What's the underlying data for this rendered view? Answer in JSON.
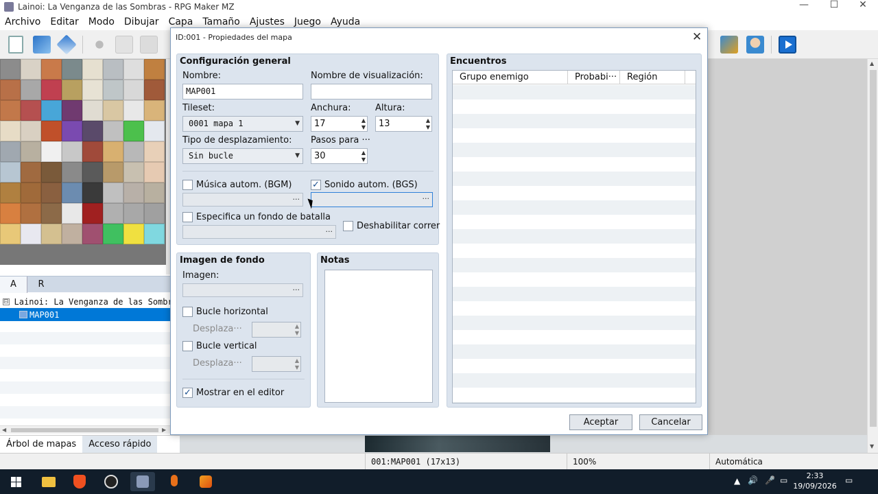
{
  "window": {
    "title": "Lainoi: La Venganza de las Sombras - RPG Maker MZ",
    "minimize": "—",
    "maximize": "☐",
    "close": "✕"
  },
  "menubar": [
    "Archivo",
    "Editar",
    "Modo",
    "Dibujar",
    "Capa",
    "Tamaño",
    "Ajustes",
    "Juego",
    "Ayuda"
  ],
  "toolbar": {
    "icons": [
      "new-project-icon",
      "open-project-icon",
      "save-project-icon",
      "cut-icon",
      "copy-icon",
      "paste-icon",
      "database-icon",
      "plugin-manager-icon",
      "character-generator-icon",
      "playtest-icon"
    ]
  },
  "palette": {
    "tabs": [
      "A",
      "R"
    ],
    "tile_colors": [
      "#8c8c8c",
      "#d9d2c6",
      "#c97a4a",
      "#7b8a8c",
      "#e6e0d0",
      "#b9bec2",
      "#dedede",
      "#c08040",
      "#b87048",
      "#a8a8a8",
      "#c04050",
      "#b8a060",
      "#e7e2d4",
      "#bfc6c8",
      "#d8d8d8",
      "#a05a3a",
      "#c2784a",
      "#b55050",
      "#48a6d8",
      "#703a70",
      "#e0dcd2",
      "#d9c7a3",
      "#e8e8e8",
      "#d9b47a",
      "#e7dcc6",
      "#d9d0c2",
      "#c0502a",
      "#7a4ab0",
      "#5a4a6a",
      "#c0c0c0",
      "#4cc04c",
      "#e4e8ee",
      "#a0a8b0",
      "#b8b0a0",
      "#f0f0f0",
      "#c8c8c8",
      "#a04a3a",
      "#d8b070",
      "#b8b8b8",
      "#e8d0b8",
      "#b7c6d2",
      "#a06a40",
      "#7a5a3a",
      "#8a8a8a",
      "#5a5a5a",
      "#b89a6a",
      "#c8c0b0",
      "#e6cab2",
      "#b08040",
      "#a06a3a",
      "#8a6040",
      "#6c8cb0",
      "#3a3a3a",
      "#c0c0c0",
      "#b8b0a8",
      "#b8b0a0",
      "#d88040",
      "#b07040",
      "#8c6a48",
      "#e8e8e8",
      "#a02020",
      "#b0b0b0",
      "#a8a8a8",
      "#a0a0a0",
      "#e8c878",
      "#e8e8f0",
      "#d4c090",
      "#c0b0a0",
      "#a05070",
      "#40c060",
      "#f0e040",
      "#80d8e0"
    ]
  },
  "map_tree": {
    "project": "Lainoi: La Venganza de las Sombras",
    "selected_map": "MAP001",
    "expander": "⊟"
  },
  "left_tabs": [
    "Árbol de mapas",
    "Acceso rápido"
  ],
  "dialog": {
    "title": "ID:001 - Propiedades del mapa",
    "close": "✕",
    "general": {
      "title": "Configuración general",
      "name_label": "Nombre:",
      "name_value": "MAP001",
      "display_name_label": "Nombre de visualización:",
      "display_name_value": "",
      "tileset_label": "Tileset:",
      "tileset_value": "0001 mapa 1",
      "width_label": "Anchura:",
      "width_value": "17",
      "height_label": "Altura:",
      "height_value": "13",
      "scroll_label": "Tipo de desplazamiento:",
      "scroll_value": "Sin bucle",
      "steps_label": "Pasos para ···",
      "steps_value": "30",
      "bgm_label": "Música autom. (BGM)",
      "bgm_checked": false,
      "bgs_label": "Sonido autom. (BGS)",
      "bgs_checked": true,
      "battleback_label": "Especifica un fondo de batalla",
      "battleback_checked": false,
      "disable_dash_label": "Deshabilitar correr",
      "disable_dash_checked": false,
      "picker_dots": "···"
    },
    "parallax": {
      "title": "Imagen de fondo",
      "image_label": "Imagen:",
      "loop_h_label": "Bucle horizontal",
      "loop_h_checked": false,
      "scroll_h_label": "Desplaza···",
      "loop_v_label": "Bucle vertical",
      "loop_v_checked": false,
      "scroll_v_label": "Desplaza···",
      "show_in_editor_label": "Mostrar en el editor",
      "show_in_editor_checked": true
    },
    "notes": {
      "title": "Notas",
      "value": ""
    },
    "encounters": {
      "title": "Encuentros",
      "columns": [
        "Grupo enemigo",
        "Probabi···",
        "Región"
      ],
      "rows": []
    },
    "ok_label": "Aceptar",
    "cancel_label": "Cancelar"
  },
  "statusbar": {
    "map_info": "001:MAP001 (17x13)",
    "zoom": "100%",
    "mode": "Automática"
  },
  "taskbar": {
    "apps": [
      "start-icon",
      "file-explorer-icon",
      "brave-browser-icon",
      "obs-icon",
      "rpg-maker-icon",
      "microphone-app-icon",
      "fl-studio-icon"
    ],
    "time": "2:33",
    "date": "19/09/2026"
  },
  "colors": {
    "selection": "#0078d7",
    "group_bg": "#dce4ee",
    "taskbar": "#111d2a"
  }
}
